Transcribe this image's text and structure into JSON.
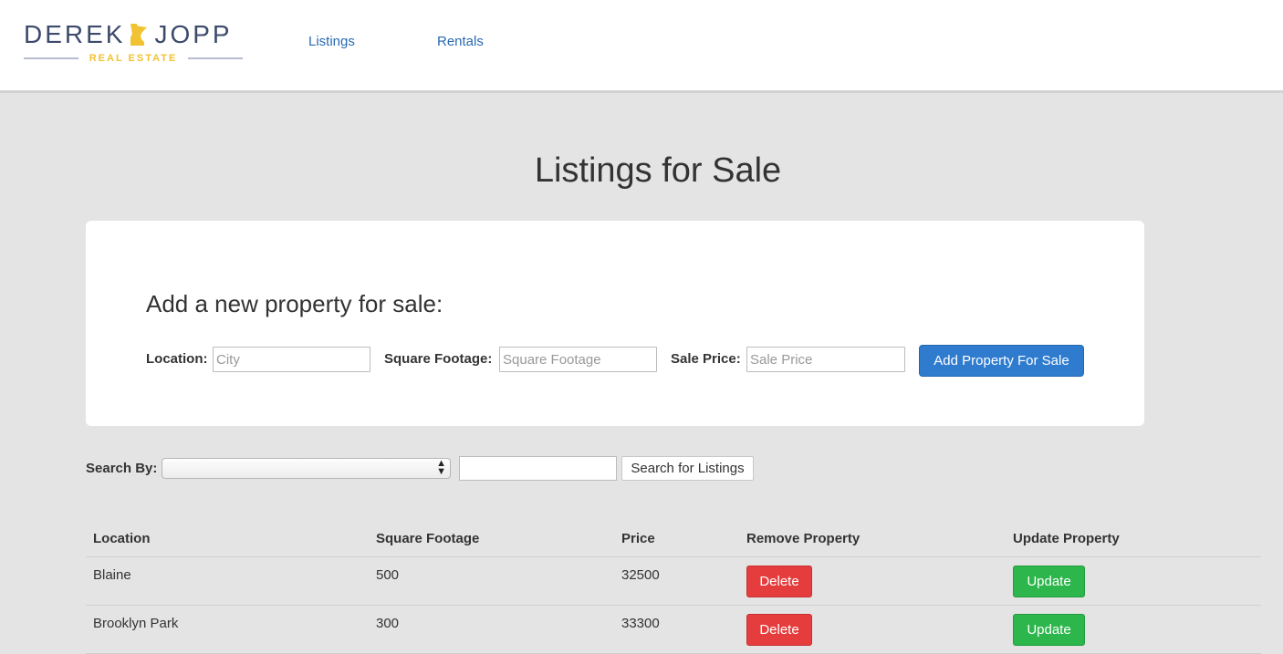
{
  "header": {
    "logo": {
      "primary_left": "DEREK",
      "primary_right": "JOPP",
      "secondary": "REAL ESTATE"
    },
    "nav": [
      {
        "label": "Listings"
      },
      {
        "label": "Rentals"
      }
    ]
  },
  "page": {
    "title": "Listings for Sale"
  },
  "add_form": {
    "heading": "Add a new property for sale:",
    "location": {
      "label": "Location:",
      "placeholder": "City",
      "value": ""
    },
    "square_footage": {
      "label": "Square Footage:",
      "placeholder": "Square Footage",
      "value": ""
    },
    "sale_price": {
      "label": "Sale Price:",
      "placeholder": "Sale Price",
      "value": ""
    },
    "submit_label": "Add Property For Sale"
  },
  "search": {
    "label": "Search By:",
    "selected": "",
    "query": "",
    "button_label": "Search for Listings"
  },
  "table": {
    "headers": [
      "Location",
      "Square Footage",
      "Price",
      "Remove Property",
      "Update Property"
    ],
    "rows": [
      {
        "location": "Blaine",
        "square_footage": "500",
        "price": "32500",
        "delete_label": "Delete",
        "update_label": "Update"
      },
      {
        "location": "Brooklyn Park",
        "square_footage": "300",
        "price": "33300",
        "delete_label": "Delete",
        "update_label": "Update"
      }
    ]
  },
  "colors": {
    "brand_navy": "#3d4a6b",
    "brand_gold": "#f1c232",
    "link_blue": "#2a6ab2",
    "primary_button": "#2f7ccf",
    "danger_button": "#e53d3d",
    "success_button": "#2cb64b",
    "page_background": "#e4e4e4"
  }
}
